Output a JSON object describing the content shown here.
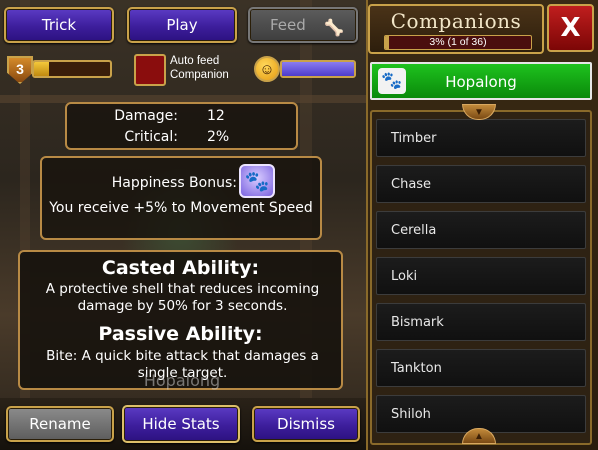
{
  "actions": {
    "trick": "Trick",
    "play": "Play",
    "feed": "Feed"
  },
  "pet_status": {
    "level": "3",
    "xp_progress": 0.2,
    "autofeed_label": "Auto feed Companion",
    "happiness_progress": 1.0
  },
  "stats": {
    "damage_label": "Damage:",
    "damage_value": "12",
    "critical_label": "Critical:",
    "critical_value": "2%"
  },
  "happiness": {
    "title": "Happiness Bonus:",
    "description": "You receive +5% to Movement Speed"
  },
  "abilities": {
    "casted_title": "Casted Ability:",
    "casted_text": "A protective shell that reduces incoming damage by 50% for 3 seconds.",
    "passive_title": "Passive Ability:",
    "passive_text": "Bite: A quick bite attack that damages a single target."
  },
  "pet_name_overlay": "Hopalong",
  "bottom": {
    "rename": "Rename",
    "hide_stats": "Hide Stats",
    "dismiss": "Dismiss"
  },
  "companions": {
    "title": "Companions",
    "progress_text": "3% (1 of 36)",
    "progress": 0.03,
    "close_label": "X",
    "selected": "Hopalong",
    "list": [
      "Timber",
      "Chase",
      "Cerella",
      "Loki",
      "Bismark",
      "Tankton",
      "Shiloh"
    ]
  },
  "icons": {
    "feed": "bone-icon",
    "happiness": "smiley-icon",
    "paw": "paw-icon",
    "close": "close-icon"
  }
}
